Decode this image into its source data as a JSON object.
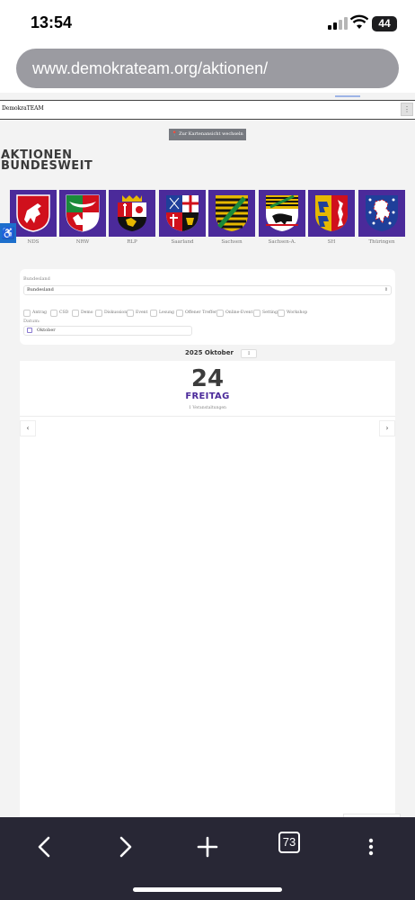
{
  "status": {
    "time": "13:54",
    "battery": "44"
  },
  "browser": {
    "url": "www.demokrateam.org/aktionen/",
    "tabs_count": "73"
  },
  "site": {
    "name": "DemokraTEAM",
    "map_button": "Zur Kartenansicht wechseln",
    "heading_line1": "AKTIONEN",
    "heading_line2": "BUNDESWEIT"
  },
  "states": [
    {
      "label": "NDS"
    },
    {
      "label": "NRW"
    },
    {
      "label": "RLP"
    },
    {
      "label": "Saarland"
    },
    {
      "label": "Sachsen"
    },
    {
      "label": "Sachsen-A."
    },
    {
      "label": "SH"
    },
    {
      "label": "Thüringen"
    }
  ],
  "filters": {
    "bundesland_label": "Bundesland",
    "bundesland_value": "Bundesland",
    "categories": [
      "Antrag",
      "CSD",
      "Demo",
      "Diskussion",
      "Event",
      "Lesung",
      "Offener Treffer",
      "Online-Event",
      "Setting",
      "Workshop"
    ],
    "datum_label": "Datum:",
    "datum_value": "Oktober"
  },
  "calendar": {
    "month": "2025 Oktober",
    "day_number": "24",
    "day_name": "FREITAG",
    "events_count": "1 Veranstaltungen"
  },
  "colors": {
    "accent": "#4b2a9a",
    "toolbar": "#282735"
  }
}
